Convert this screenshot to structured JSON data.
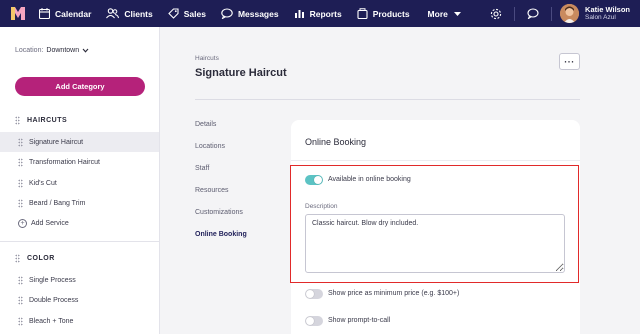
{
  "topnav": {
    "items": [
      {
        "label": "Calendar",
        "icon": "calendar-icon"
      },
      {
        "label": "Clients",
        "icon": "clients-icon"
      },
      {
        "label": "Sales",
        "icon": "tag-icon"
      },
      {
        "label": "Messages",
        "icon": "chat-icon"
      },
      {
        "label": "Reports",
        "icon": "chart-icon"
      },
      {
        "label": "Products",
        "icon": "box-icon"
      }
    ],
    "more_label": "More",
    "user": {
      "name": "Katie Wilson",
      "org": "Salon Azul"
    },
    "colors": {
      "bar": "#1e1e55",
      "accent": "#b5227a"
    }
  },
  "sidebar": {
    "location_label": "Location:",
    "location_value": "Downtown",
    "add_category_label": "Add Category",
    "categories": [
      {
        "name": "HAIRCUTS",
        "services": [
          "Signature Haircut",
          "Transformation Haircut",
          "Kid's Cut",
          "Beard / Bang Trim"
        ],
        "add_service_label": "Add Service"
      },
      {
        "name": "COLOR",
        "services": [
          "Single Process",
          "Double Process",
          "Bleach + Tone"
        ]
      }
    ],
    "active_service": "Signature Haircut"
  },
  "main": {
    "breadcrumb": "Haircuts",
    "title": "Signature Haircut",
    "more_button": "···",
    "subnav": [
      "Details",
      "Locations",
      "Staff",
      "Resources",
      "Customizations",
      "Online Booking"
    ],
    "active_subnav": "Online Booking"
  },
  "card": {
    "title": "Online Booking",
    "available_label": "Available in online booking",
    "available_on": true,
    "description_label": "Description",
    "description_value": "Classic haircut. Blow dry included.",
    "min_price_label": "Show price as minimum price (e.g. $100+)",
    "min_price_on": false,
    "prompt_call_label": "Show prompt-to-call",
    "prompt_call_on": false
  }
}
